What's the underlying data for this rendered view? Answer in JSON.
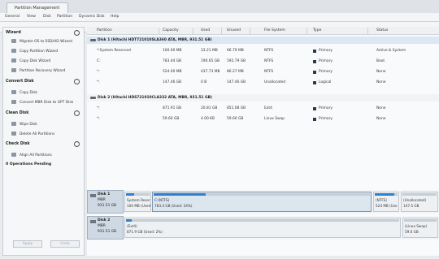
{
  "window": {
    "tab_title": "Partition Management"
  },
  "menu": [
    "General",
    "View",
    "Disk",
    "Partition",
    "Dynamic Disk",
    "Help"
  ],
  "sidebar": {
    "wizard": {
      "title": "Wizard",
      "items": [
        "Migrate OS to SSD/HD Wizard",
        "Copy Partition Wizard",
        "Copy Disk Wizard",
        "Partition Recovery Wizard"
      ]
    },
    "convert": {
      "title": "Convert Disk",
      "items": [
        "Copy Disk",
        "Convert MBR Disk to GPT Disk"
      ]
    },
    "clean": {
      "title": "Clean Disk",
      "items": [
        "Wipe Disk",
        "Delete All Partitions"
      ]
    },
    "check": {
      "title": "Check Disk",
      "items": [
        "Align All Partitions"
      ]
    },
    "pending": "0 Operations Pending",
    "apply": "Apply",
    "undo": "Undo"
  },
  "table": {
    "headers": [
      "Partition",
      "Capacity",
      "Used",
      "Unused",
      "File System",
      "Type",
      "Status"
    ],
    "disk1": "Disk 1 (Hitachi HDT721010SLA360 ATA, MBR, 931.51 GB)",
    "disk2": "Disk 2 (Hitachi HDS721010CLA332 ATA, MBR, 931.51 GB)",
    "rows1": [
      [
        "*:System Reserved",
        "100.00 MB",
        "33.21 MB",
        "66.79 MB",
        "NTFS",
        "Primary",
        "Active & System"
      ],
      [
        "C:",
        "783.44 GB",
        "190.65 GB",
        "592.79 GB",
        "NTFS",
        "Primary",
        "Boot"
      ],
      [
        "*:",
        "524.00 MB",
        "437.73 MB",
        "86.27 MB",
        "NTFS",
        "Primary",
        "None"
      ],
      [
        "*:",
        "147.46 GB",
        "0 B",
        "147.46 GB",
        "Unallocated",
        "Logical",
        "None"
      ]
    ],
    "rows2": [
      [
        "*:",
        "871.91 GB",
        "20.81 GB",
        "851.08 GB",
        "Ext4",
        "Primary",
        "None"
      ],
      [
        "*:",
        "59.60 GB",
        "4.00 KB",
        "59.60 GB",
        "Linux Swap",
        "Primary",
        "None"
      ]
    ]
  },
  "map": {
    "disk1": {
      "name": "Disk 1",
      "scheme": "MBR",
      "size": "931.51 GB",
      "parts": [
        {
          "label": "System Reser",
          "sub": "100 MB (Used",
          "used_fraction": 0.33
        },
        {
          "label": "C:(NTFS)",
          "sub": "783.4 GB (Used: 24%)",
          "used_fraction": 0.24
        },
        {
          "label": "(NTFS)",
          "sub": "524 MB (Use",
          "used_fraction": 0.84
        },
        {
          "label": "(Unallocated)",
          "sub": "147.5 GB",
          "used_fraction": 0
        }
      ]
    },
    "disk2": {
      "name": "Disk 2",
      "scheme": "MBR",
      "size": "931.51 GB",
      "parts": [
        {
          "label": "(Ext4)",
          "sub": "871.9 GB (Used: 2%)",
          "used_fraction": 0.02
        },
        {
          "label": "(Linux Swap)",
          "sub": "59.6 GB",
          "used_fraction": 0
        }
      ]
    }
  }
}
